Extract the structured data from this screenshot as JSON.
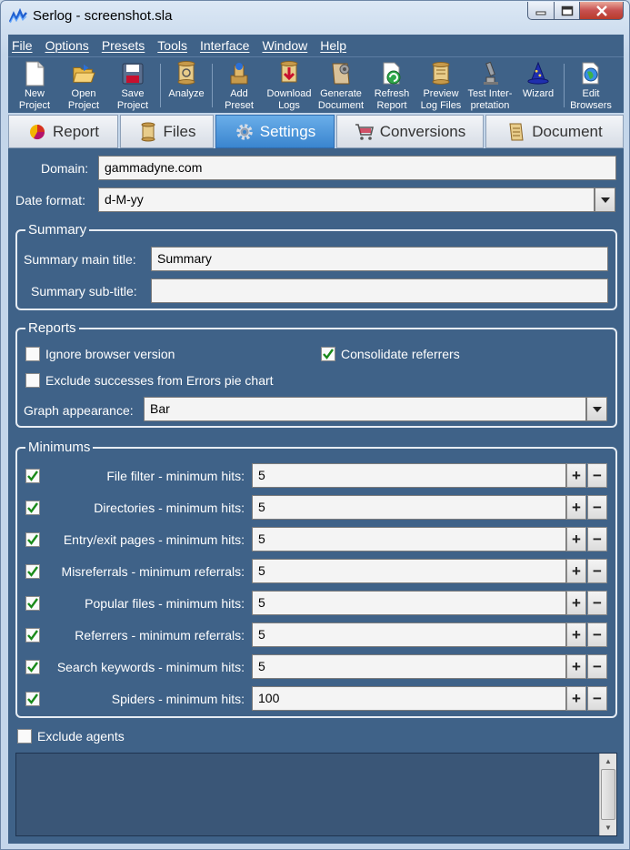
{
  "window": {
    "title": "Serlog - screenshot.sla"
  },
  "menu": [
    "File",
    "Options",
    "Presets",
    "Tools",
    "Interface",
    "Window",
    "Help"
  ],
  "toolbar": [
    {
      "l1": "New",
      "l2": "Project",
      "icon": "new-document-icon"
    },
    {
      "l1": "Open",
      "l2": "Project",
      "icon": "open-folder-icon"
    },
    {
      "l1": "Save",
      "l2": "Project",
      "icon": "save-disk-icon"
    },
    {
      "l1": "Analyze",
      "l2": "",
      "icon": "scroll-analyze-icon"
    },
    {
      "l1": "Add",
      "l2": "Preset",
      "icon": "add-preset-icon"
    },
    {
      "l1": "Download",
      "l2": "Logs",
      "icon": "download-logs-icon"
    },
    {
      "l1": "Generate",
      "l2": "Document",
      "icon": "generate-document-icon"
    },
    {
      "l1": "Refresh",
      "l2": "Report",
      "icon": "refresh-report-icon"
    },
    {
      "l1": "Preview",
      "l2": "Log Files",
      "icon": "preview-log-icon"
    },
    {
      "l1": "Test Inter-",
      "l2": "pretation",
      "icon": "microscope-icon"
    },
    {
      "l1": "Wizard",
      "l2": "",
      "icon": "wizard-hat-icon"
    },
    {
      "l1": "Edit",
      "l2": "Browsers",
      "icon": "edit-browsers-icon"
    }
  ],
  "tabs": [
    {
      "label": "Report",
      "icon": "pie-chart-icon"
    },
    {
      "label": "Files",
      "icon": "files-scroll-icon"
    },
    {
      "label": "Settings",
      "icon": "gear-icon",
      "active": true
    },
    {
      "label": "Conversions",
      "icon": "shopping-cart-icon"
    },
    {
      "label": "Document",
      "icon": "document-scroll-icon"
    }
  ],
  "settings": {
    "domain_label": "Domain:",
    "domain_value": "gammadyne.com",
    "date_format_label": "Date format:",
    "date_format_value": "d-M-yy",
    "summary": {
      "title": "Summary",
      "main_title_label": "Summary main title:",
      "main_title_value": "Summary",
      "sub_title_label": "Summary sub-title:",
      "sub_title_value": ""
    },
    "reports": {
      "title": "Reports",
      "ignore_browser_version": {
        "label": "Ignore browser version",
        "checked": false
      },
      "consolidate_referrers": {
        "label": "Consolidate referrers",
        "checked": true
      },
      "exclude_successes": {
        "label": "Exclude successes from Errors pie chart",
        "checked": false
      },
      "graph_label": "Graph appearance:",
      "graph_value": "Bar"
    },
    "minimums": {
      "title": "Minimums",
      "rows": [
        {
          "label": "File filter - minimum hits:",
          "value": "5",
          "checked": true
        },
        {
          "label": "Directories - minimum hits:",
          "value": "5",
          "checked": true
        },
        {
          "label": "Entry/exit pages - minimum hits:",
          "value": "5",
          "checked": true
        },
        {
          "label": "Misreferrals - minimum referrals:",
          "value": "5",
          "checked": true
        },
        {
          "label": "Popular files - minimum hits:",
          "value": "5",
          "checked": true
        },
        {
          "label": "Referrers - minimum referrals:",
          "value": "5",
          "checked": true
        },
        {
          "label": "Search keywords - minimum hits:",
          "value": "5",
          "checked": true
        },
        {
          "label": "Spiders - minimum hits:",
          "value": "100",
          "checked": true
        }
      ],
      "plus": "+",
      "minus": "−"
    },
    "exclude_agents": {
      "label": "Exclude agents",
      "checked": false
    }
  },
  "colors": {
    "panel": "#3f6288",
    "active_tab": "#3a85cf",
    "check": "#1a8a1a"
  }
}
